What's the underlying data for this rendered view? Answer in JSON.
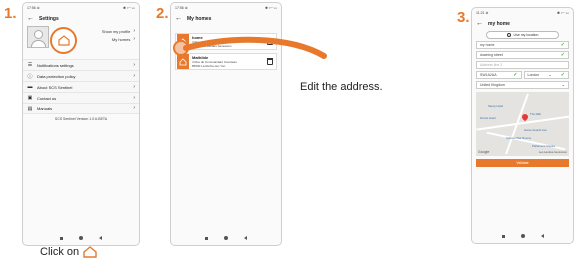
{
  "steps": {
    "one": "1.",
    "two": "2.",
    "three": "3."
  },
  "colors": {
    "accent": "#e8792c",
    "valid": "#3cb043"
  },
  "phone1": {
    "status_time": "17:56 ⊛",
    "status_icons": "✱ ▿◔ ▭",
    "header_title": "Settings",
    "show_profile": "Show my profile",
    "my_homes": "My homes",
    "menu": [
      {
        "icon": "sliders-icon",
        "label": "Notifications settings"
      },
      {
        "icon": "info-icon",
        "label": "Data protection policy"
      },
      {
        "icon": "scs-logo-icon",
        "label": "About SCS Sentinel"
      },
      {
        "icon": "contact-icon",
        "label": "Contact us"
      },
      {
        "icon": "manual-icon",
        "label": "Manuals"
      }
    ],
    "version": "SCS Sentinel Version 1.0.6-BETA"
  },
  "phone2": {
    "status_time": "17:56 ⊛",
    "status_icons": "✱ ▿◔ ▭",
    "header_title": "My homes",
    "homes": [
      {
        "name": "home",
        "address_line1": "4 Rue du Commandant Cousteau",
        "address_line2": "85000 Les Landes-Genusson"
      },
      {
        "name": "Mathilde",
        "address_line1": "4 Rue du Commandant Cousteau",
        "address_line2": "85000 La Roche-sur-Yon"
      }
    ]
  },
  "phone3": {
    "status_time": "11:21 ⊛",
    "status_icons": "✱ ▿◔ ▭",
    "header_title": "my home",
    "use_location": "Use my location",
    "fields": {
      "name": "my home",
      "street": "downing street",
      "address2_placeholder": "Address line 2",
      "postcode": "SW1A2AA",
      "city": "London",
      "country": "United Kingdom"
    },
    "map_labels": [
      "Savoy Hotel",
      "Dorset Hotel",
      "The Mall",
      "Horse Guards Ave",
      "Cabinet War Rooms",
      "Parliament Square"
    ],
    "google": "Google",
    "map_corner_label": "Les Landes-Genusson",
    "cta": "Validate"
  },
  "captions": {
    "edit": "Edit the address.",
    "click_on": "Click on"
  }
}
